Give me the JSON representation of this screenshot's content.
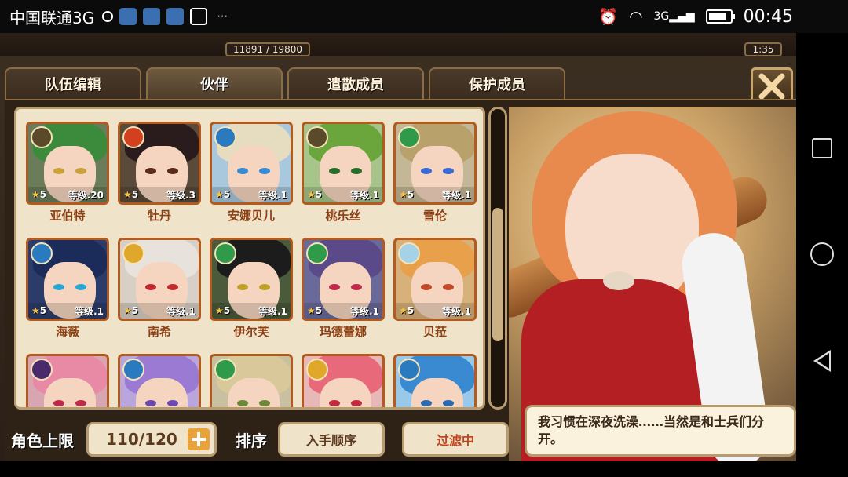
{
  "statusbar": {
    "carrier": "中国联通3G",
    "time": "00:45",
    "network": "3G"
  },
  "top": {
    "exp": "11891 / 19800",
    "timer": "1:35"
  },
  "tabs": [
    {
      "label": "队伍编辑",
      "active": false
    },
    {
      "label": "伙伴",
      "active": true
    },
    {
      "label": "遣散成员",
      "active": false
    },
    {
      "label": "保护成员",
      "active": false
    }
  ],
  "characters": [
    {
      "name": "亚伯特",
      "stars": "5",
      "level": "等级.20",
      "hair": "#3c8a3c",
      "eye": "#caa23c",
      "bg": "#6a7c5a",
      "elem": "#5a4a2a"
    },
    {
      "name": "牡丹",
      "stars": "5",
      "level": "等级.3",
      "hair": "#2a1c1c",
      "eye": "#5a2a1a",
      "bg": "#5a4a3a",
      "elem": "#d2401e"
    },
    {
      "name": "安娜贝儿",
      "stars": "5",
      "level": "等级.1",
      "hair": "#e6dcc0",
      "eye": "#3c8ad2",
      "bg": "#a9c7dd",
      "elem": "#2a7ac0"
    },
    {
      "name": "桃乐丝",
      "stars": "5",
      "level": "等级.1",
      "hair": "#6aa63c",
      "eye": "#2a6a2a",
      "bg": "#a7c58a",
      "elem": "#5a4a2a"
    },
    {
      "name": "雪伦",
      "stars": "5",
      "level": "等级.1",
      "hair": "#b8a16a",
      "eye": "#3c6ad2",
      "bg": "#c4b796",
      "elem": "#2e9a4a"
    },
    {
      "name": "海薇",
      "stars": "5",
      "level": "等级.1",
      "hair": "#1c2c5a",
      "eye": "#2aa6d2",
      "bg": "#2c3c6a",
      "elem": "#2a7ac0"
    },
    {
      "name": "南希",
      "stars": "5",
      "level": "等级.1",
      "hair": "#e8e2dc",
      "eye": "#c02a2a",
      "bg": "#d8cfc7",
      "elem": "#e0a82a"
    },
    {
      "name": "伊尔芙",
      "stars": "5",
      "level": "等级.1",
      "hair": "#1c1c1c",
      "eye": "#c0a02a",
      "bg": "#4a5a3a",
      "elem": "#2e9a4a"
    },
    {
      "name": "玛德蕾娜",
      "stars": "5",
      "level": "等级.1",
      "hair": "#5a4a8a",
      "eye": "#c02a4a",
      "bg": "#6a6a9a",
      "elem": "#2e9a4a"
    },
    {
      "name": "贝菈",
      "stars": "5",
      "level": "等级.1",
      "hair": "#e8a04a",
      "eye": "#c04a2a",
      "bg": "#d8b17a",
      "elem": "#a6d2e8"
    },
    {
      "name": "",
      "stars": "",
      "level": "",
      "hair": "#e88aa6",
      "eye": "#c02a4a",
      "bg": "#d8a6b0",
      "elem": "#4a2a6a"
    },
    {
      "name": "",
      "stars": "",
      "level": "",
      "hair": "#9a7ad2",
      "eye": "#6a4ab0",
      "bg": "#b8a6dd",
      "elem": "#2a7ac0"
    },
    {
      "name": "",
      "stars": "",
      "level": "",
      "hair": "#d8c89a",
      "eye": "#6a8a3a",
      "bg": "#c8c0a0",
      "elem": "#2e9a4a"
    },
    {
      "name": "",
      "stars": "",
      "level": "",
      "hair": "#e86a7a",
      "eye": "#c02a3a",
      "bg": "#e8b8b8",
      "elem": "#e0a82a"
    },
    {
      "name": "",
      "stars": "",
      "level": "",
      "hair": "#3a8ad2",
      "eye": "#2a6ab0",
      "bg": "#9ac8e8",
      "elem": "#2a7ac0"
    }
  ],
  "bottom": {
    "limit_label": "角色上限",
    "limit_value": "110/120",
    "sort_label": "排序",
    "sort_value": "入手顺序",
    "filter_value": "过滤中"
  },
  "speech": "我习惯在深夜洗澡……当然是和士兵们分开。"
}
